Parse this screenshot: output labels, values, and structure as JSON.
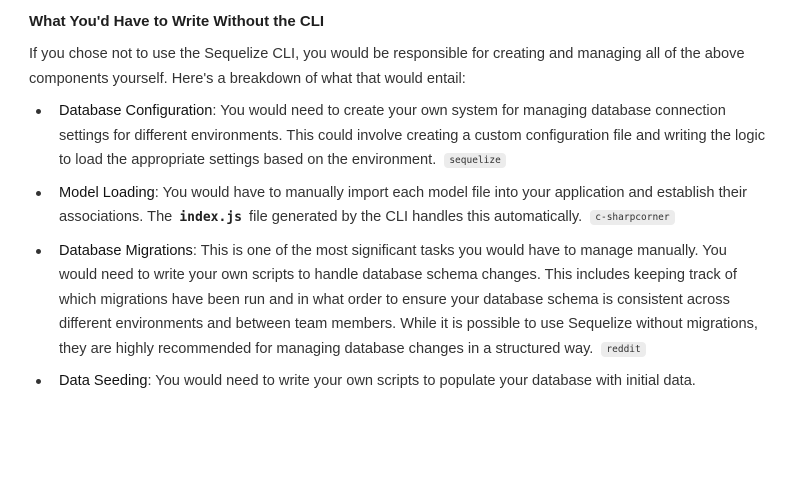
{
  "heading": "What You'd Have to Write Without the CLI",
  "intro": "If you chose not to use the Sequelize CLI, you would be responsible for creating and managing all of the above components yourself. Here's a breakdown of what that would entail:",
  "items": [
    {
      "term": "Database Configuration",
      "text_before": ": You would need to create your own system for managing database connection settings for different environments. This could involve creating a custom configuration file and writing the logic to load the appropriate settings based on the environment.",
      "source": "sequelize"
    },
    {
      "term": "Model Loading",
      "text_before": ": You would have to manually import each model file into your application and establish their associations. The ",
      "code": "index.js",
      "text_after": " file generated by the CLI handles this automatically.",
      "source": "c-sharpcorner"
    },
    {
      "term": "Database Migrations",
      "text_before": ": This is one of the most significant tasks you would have to manage manually. You would need to write your own scripts to handle database schema changes. This includes keeping track of which migrations have been run and in what order to ensure your database schema is consistent across different environments and between team members. While it is possible to use Sequelize without migrations, they are highly recommended for managing database changes in a structured way.",
      "source": "reddit"
    },
    {
      "term": "Data Seeding",
      "text_before": ": You would need to write your own scripts to populate your database with initial data."
    }
  ]
}
